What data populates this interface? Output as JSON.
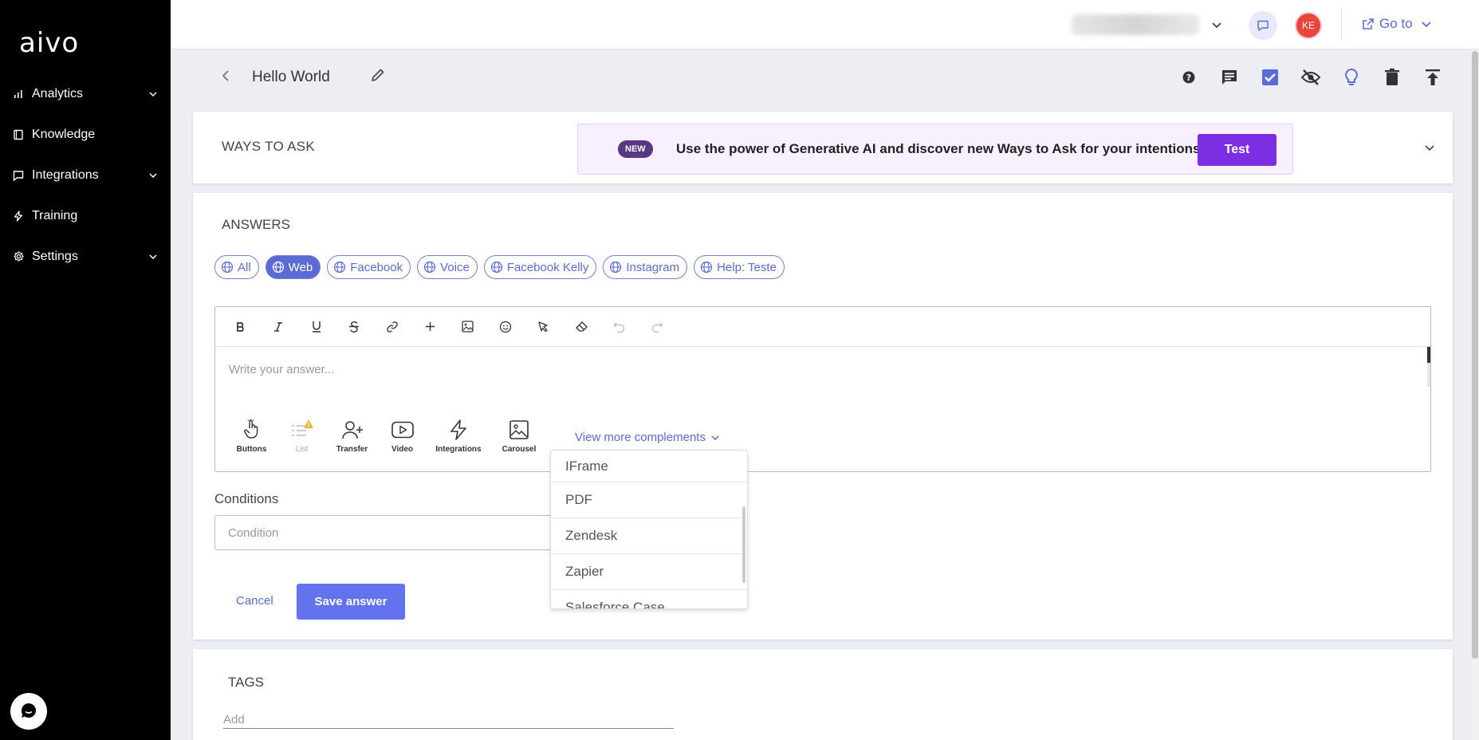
{
  "brand": {
    "logo": "aivo"
  },
  "sidebar": {
    "items": [
      {
        "label": "Analytics",
        "icon": "bar-chart-icon",
        "expandable": true
      },
      {
        "label": "Knowledge",
        "icon": "book-icon",
        "expandable": false
      },
      {
        "label": "Integrations",
        "icon": "message-square-icon",
        "expandable": true
      },
      {
        "label": "Training",
        "icon": "lightning-icon",
        "expandable": false
      },
      {
        "label": "Settings",
        "icon": "gear-icon",
        "expandable": true
      }
    ]
  },
  "topbar": {
    "avatar_initials": "KE",
    "goto_label": "Go to"
  },
  "header": {
    "title": "Hello World"
  },
  "ways_to_ask": {
    "title": "WAYS TO ASK",
    "badge": "NEW",
    "promo_text": "Use the power of Generative AI and discover new Ways to Ask for your intentions.",
    "test_label": "Test"
  },
  "answers": {
    "title": "ANSWERS",
    "channels": [
      "All",
      "Web",
      "Facebook",
      "Voice",
      "Facebook Kelly",
      "Instagram",
      "Help: Teste"
    ],
    "active_channel": "Web",
    "placeholder": "Write your answer...",
    "complements": [
      {
        "label": "Buttons",
        "icon": "pointer-hand-icon"
      },
      {
        "label": "List",
        "icon": "list-warning-icon",
        "disabled": true
      },
      {
        "label": "Transfer",
        "icon": "user-plus-icon"
      },
      {
        "label": "Video",
        "icon": "youtube-icon"
      },
      {
        "label": "Integrations",
        "icon": "lightning-icon"
      },
      {
        "label": "Carousel",
        "icon": "image-icon"
      }
    ],
    "view_more": "View more complements",
    "conditions_label": "Conditions",
    "condition_placeholder": "Condition",
    "cancel_label": "Cancel",
    "save_label": "Save answer"
  },
  "dropdown": {
    "items": [
      "IFrame",
      "PDF",
      "Zendesk",
      "Zapier",
      "Salesforce Case"
    ]
  },
  "tags": {
    "title": "TAGS",
    "placeholder": "Add"
  },
  "colors": {
    "accent": "#5b6bd5",
    "promo_button": "#7c2ee3",
    "badge": "#5a3785",
    "avatar": "#e8453c"
  }
}
